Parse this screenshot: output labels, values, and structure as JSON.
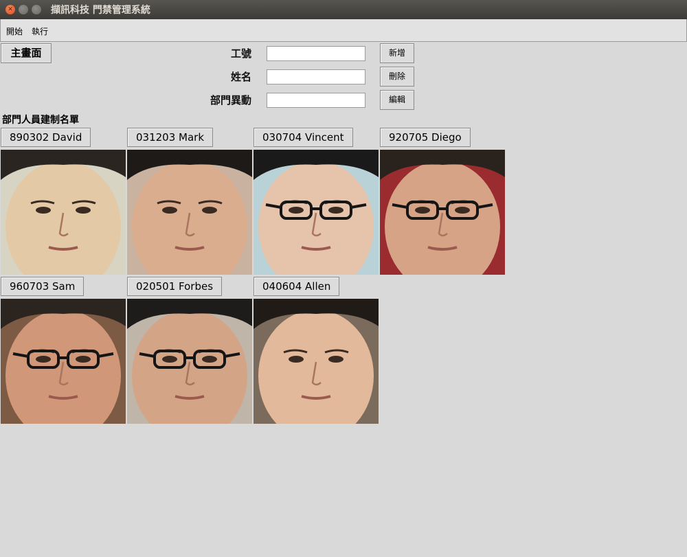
{
  "window": {
    "title": "擷訊科技 門禁管理系統"
  },
  "menu": {
    "items": [
      "開始",
      "執行"
    ]
  },
  "toolbar": {
    "main_button": "主畫面",
    "fields": {
      "id_label": "工號",
      "name_label": "姓名",
      "dept_label": "部門異動"
    },
    "add_button": "新增",
    "delete_button": "刪除",
    "edit_button": "編輯"
  },
  "roster": {
    "heading": "部門人員建制名單",
    "people": [
      {
        "label": "890302 David",
        "skin": "#e3c9a6",
        "hair": "#2a2520",
        "glasses": false,
        "bg": "#d8d4c4"
      },
      {
        "label": "031203 Mark",
        "skin": "#d9ad8e",
        "hair": "#1d1a18",
        "glasses": false,
        "bg": "#c9b3a0"
      },
      {
        "label": "030704 Vincent",
        "skin": "#e6c4ab",
        "hair": "#1a1a1a",
        "glasses": true,
        "bg": "#b9d2d8"
      },
      {
        "label": "920705 Diego",
        "skin": "#d6a386",
        "hair": "#2a221c",
        "glasses": true,
        "bg": "#9a2c30"
      },
      {
        "label": "960703 Sam",
        "skin": "#d09878",
        "hair": "#2b241f",
        "glasses": true,
        "bg": "#7d5a44"
      },
      {
        "label": "020501 Forbes",
        "skin": "#d4a487",
        "hair": "#1e1c1a",
        "glasses": true,
        "bg": "#bfb5a8"
      },
      {
        "label": "040604 Allen",
        "skin": "#e3b99b",
        "hair": "#201b17",
        "glasses": false,
        "bg": "#7b6b5c"
      }
    ]
  }
}
